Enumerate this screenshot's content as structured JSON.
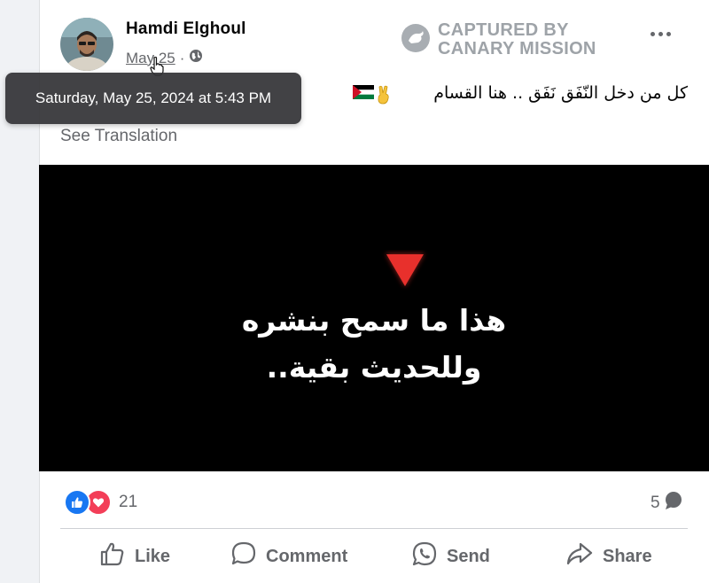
{
  "post": {
    "author": "Hamdi Elghoul",
    "date": "May 25",
    "separator": "·",
    "tooltip": "Saturday, May 25, 2024 at 5:43 PM",
    "text": "كل من دخل النّفَق نَفَق .. هنا القسام",
    "see_translation": "See Translation",
    "media_overlay": {
      "line1": "هذا ما سمح بنشره",
      "line2": "وللحديث بقية.."
    },
    "reaction_count": "21",
    "comment_count": "5"
  },
  "watermark": {
    "line1": "CAPTURED BY",
    "line2": "CANARY MISSION"
  },
  "actions": {
    "like": "Like",
    "comment": "Comment",
    "send": "Send",
    "share": "Share"
  },
  "icons": {
    "privacy": "globe-icon",
    "more": "more-options-icon",
    "reactions": [
      "like-reaction-icon",
      "love-reaction-icon"
    ]
  },
  "colors": {
    "like_blue": "#1877f2",
    "love_red": "#f33e58",
    "triangle_red": "#e8302c",
    "secondary_text": "#65676b"
  }
}
